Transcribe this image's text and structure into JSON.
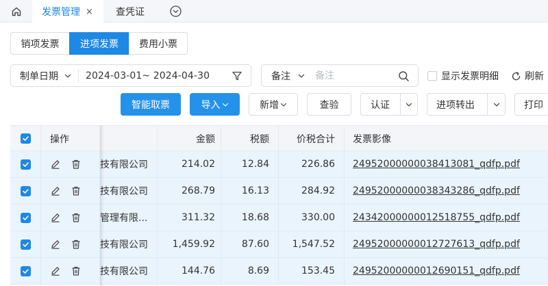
{
  "topbar": {
    "home_icon": "home-icon",
    "tabs": [
      {
        "label": "发票管理",
        "active": true,
        "closable": true
      },
      {
        "label": "查凭证",
        "active": false
      }
    ],
    "close_glyph": "×",
    "more_icon": "chevron-down-circle-icon"
  },
  "segments": [
    {
      "label": "销项发票",
      "active": false
    },
    {
      "label": "进项发票",
      "active": true
    },
    {
      "label": "费用小票",
      "active": false
    }
  ],
  "filters": {
    "date": {
      "label": "制单日期",
      "range": "2024-03-01~ 2024-04-30"
    },
    "remark": {
      "label": "备注",
      "placeholder": "备注",
      "value": ""
    },
    "show_detail": {
      "label": "显示发票明细",
      "checked": false
    },
    "refresh": {
      "label": "刷新"
    }
  },
  "actions": {
    "smart_fetch": "智能取票",
    "import": "导入",
    "add": "新增",
    "check": "查验",
    "certify": "认证",
    "transfer_out": "进项转出",
    "print": "打印"
  },
  "table": {
    "columns": {
      "ops": "操作",
      "amount": "金额",
      "tax": "税额",
      "total": "价税合计",
      "image": "发票影像"
    },
    "rows": [
      {
        "checked": true,
        "name": "技有限公司",
        "amount": "214.02",
        "tax": "12.84",
        "total": "226.86",
        "image": "24952000000038413081_qdfp.pdf"
      },
      {
        "checked": true,
        "name": "技有限公司",
        "amount": "268.79",
        "tax": "16.13",
        "total": "284.92",
        "image": "24952000000038343286_qdfp.pdf"
      },
      {
        "checked": true,
        "name": "管理有限...",
        "amount": "311.32",
        "tax": "18.68",
        "total": "330.00",
        "image": "24342000000012518755_qdfp.pdf"
      },
      {
        "checked": true,
        "name": "技有限公司",
        "amount": "1,459.92",
        "tax": "87.60",
        "total": "1,547.52",
        "image": "24952000000012727613_qdfp.pdf"
      },
      {
        "checked": true,
        "name": "技有限公司",
        "amount": "144.76",
        "tax": "8.69",
        "total": "153.45",
        "image": "24952000000012690151_qdfp.pdf"
      }
    ]
  },
  "colors": {
    "primary": "#1e88e5",
    "row_selected": "#eaf4fd",
    "header_bg": "#f3f5f8"
  }
}
